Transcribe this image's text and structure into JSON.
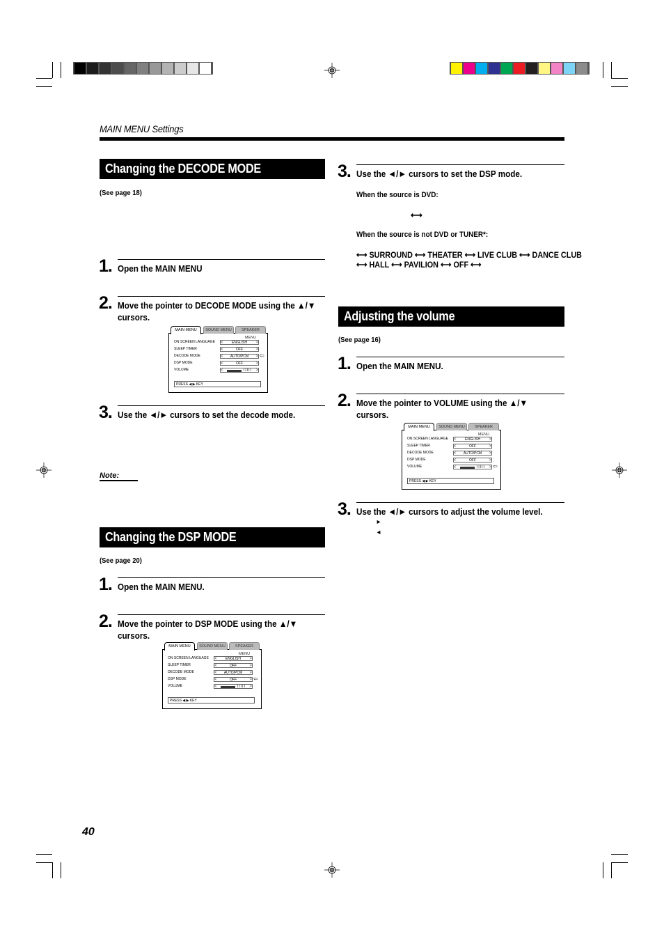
{
  "header": {
    "running_title": "MAIN MENU Settings"
  },
  "print_marks": {
    "gray_bar": [
      "#000000",
      "#1c1c1c",
      "#333333",
      "#4d4d4d",
      "#666666",
      "#808080",
      "#999999",
      "#b3b3b3",
      "#cccccc",
      "#e6e6e6",
      "#ffffff"
    ],
    "color_bar": [
      "#fff200",
      "#ec008c",
      "#00aeef",
      "#2e3192",
      "#00a651",
      "#ed1c24",
      "#231f20",
      "#fff684",
      "#f384c5",
      "#7dd4f7",
      "#8c8c8c"
    ]
  },
  "decode_mode": {
    "title": "Changing the DECODE MODE",
    "see_page": "(See page 18)",
    "steps": [
      {
        "num": "1.",
        "text": "Open the MAIN MENU"
      },
      {
        "num": "2.",
        "text": "Move the pointer to DECODE MODE using the ▲/▼",
        "text2": "cursors."
      },
      {
        "num": "3.",
        "text": "Use the ◄/► cursors to set the decode mode."
      }
    ],
    "note_label": "Note:"
  },
  "dsp_mode": {
    "title": "Changing the DSP MODE",
    "see_page": "(See page 20)",
    "steps": [
      {
        "num": "1.",
        "text": "Open the MAIN MENU."
      },
      {
        "num": "2.",
        "text": "Move the pointer to DSP MODE using the ▲/▼",
        "text2": "cursors."
      },
      {
        "num": "3.",
        "text": "Use the ◄/► cursors to set the DSP mode."
      }
    ],
    "dvd_label": "When the source is DVD:",
    "dvd_sequence": "⟷",
    "other_label": "When the source is not DVD or TUNER*:",
    "other_sequence_line1": "⟷ SURROUND ⟷ THEATER ⟷ LIVE CLUB ⟷ DANCE CLUB",
    "other_sequence_line2": "⟷ HALL ⟷ PAVILION ⟷ OFF ⟷"
  },
  "volume": {
    "title": "Adjusting the volume",
    "see_page": "(See page 16)",
    "steps": [
      {
        "num": "1.",
        "text": "Open the MAIN MENU."
      },
      {
        "num": "2.",
        "text": "Move the pointer to VOLUME using the ▲/▼",
        "text2": "cursors."
      },
      {
        "num": "3.",
        "text": "Use the ◄/► cursors to adjust the volume level."
      }
    ],
    "right_arrow": "►",
    "left_arrow": "◄"
  },
  "osd_menu": {
    "tabs": [
      "MAIN MENU",
      "SOUND MENU",
      "SPEAKER MENU"
    ],
    "rows": [
      {
        "label": "ON SCREEN LANGUAGE",
        "value": "ENGLISH"
      },
      {
        "label": "SLEEP TIMER",
        "value": "OFF"
      },
      {
        "label": "DECODE MODE",
        "value": "AUTO/PCM"
      },
      {
        "label": "DSP MODE",
        "value": "OFF"
      },
      {
        "label": "VOLUME",
        "value": ""
      }
    ],
    "volume_level": 0.45,
    "volume_ticks": "I I I I I",
    "press_hint": "PRESS ◀ ▶ KEY",
    "arrow_left": "<",
    "arrow_right": ">",
    "pointer": "⇦"
  },
  "figures": [
    {
      "pointer_row": 2
    },
    {
      "pointer_row": 3
    },
    {
      "pointer_row": 4
    }
  ],
  "footer": {
    "page_number": "40"
  }
}
